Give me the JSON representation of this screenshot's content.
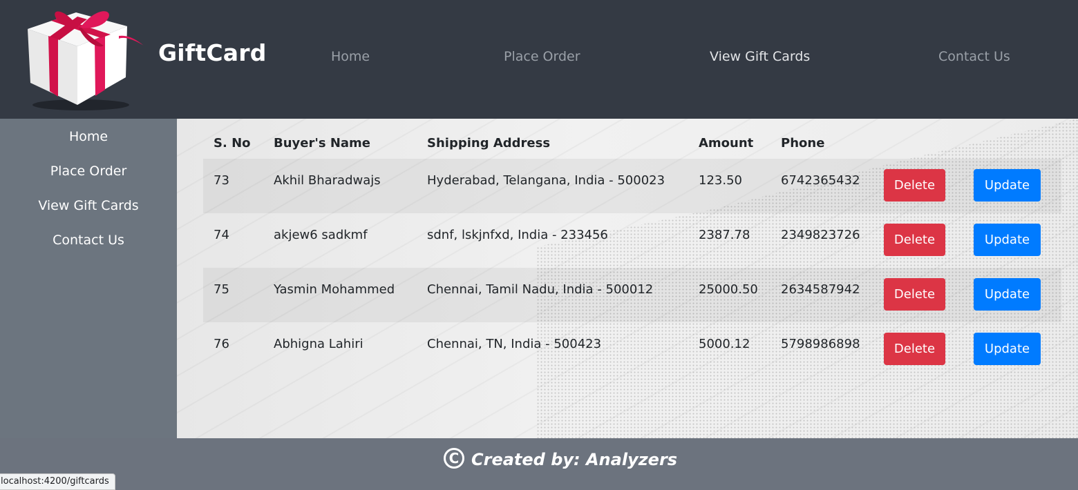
{
  "brand": {
    "name": "GiftCard",
    "logo": "gift-box-logo"
  },
  "topnav": {
    "items": [
      {
        "label": "Home",
        "active": false
      },
      {
        "label": "Place Order",
        "active": false
      },
      {
        "label": "View Gift Cards",
        "active": true
      },
      {
        "label": "Contact Us",
        "active": false
      }
    ]
  },
  "sidebar": {
    "items": [
      {
        "label": "Home"
      },
      {
        "label": "Place Order"
      },
      {
        "label": "View Gift Cards"
      },
      {
        "label": "Contact Us"
      }
    ]
  },
  "table": {
    "headers": [
      "S. No",
      "Buyer's Name",
      "Shipping Address",
      "Amount",
      "Phone"
    ],
    "rows": [
      {
        "sno": "73",
        "name": "Akhil Bharadwajs",
        "address": "Hyderabad, Telangana, India - 500023",
        "amount": "123.50",
        "phone": "6742365432",
        "delete": "Delete",
        "update": "Update"
      },
      {
        "sno": "74",
        "name": "akjew6 sadkmf",
        "address": "sdnf, lskjnfxd, India - 233456",
        "amount": "2387.78",
        "phone": "2349823726",
        "delete": "Delete",
        "update": "Update"
      },
      {
        "sno": "75",
        "name": "Yasmin Mohammed",
        "address": "Chennai, Tamil Nadu, India - 500012",
        "amount": "25000.50",
        "phone": "2634587942",
        "delete": "Delete",
        "update": "Update"
      },
      {
        "sno": "76",
        "name": "Abhigna Lahiri",
        "address": "Chennai, TN, India - 500423",
        "amount": "5000.12",
        "phone": "5798986898",
        "delete": "Delete",
        "update": "Update"
      }
    ]
  },
  "footer": {
    "text": "Created by: Analyzers",
    "copyright_symbol": "C"
  },
  "status_bar": {
    "url": "localhost:4200/giftcards"
  },
  "colors": {
    "navbar": "#343a44",
    "sidebar": "#6c757f",
    "danger": "#dc3545",
    "primary": "#007bff"
  }
}
